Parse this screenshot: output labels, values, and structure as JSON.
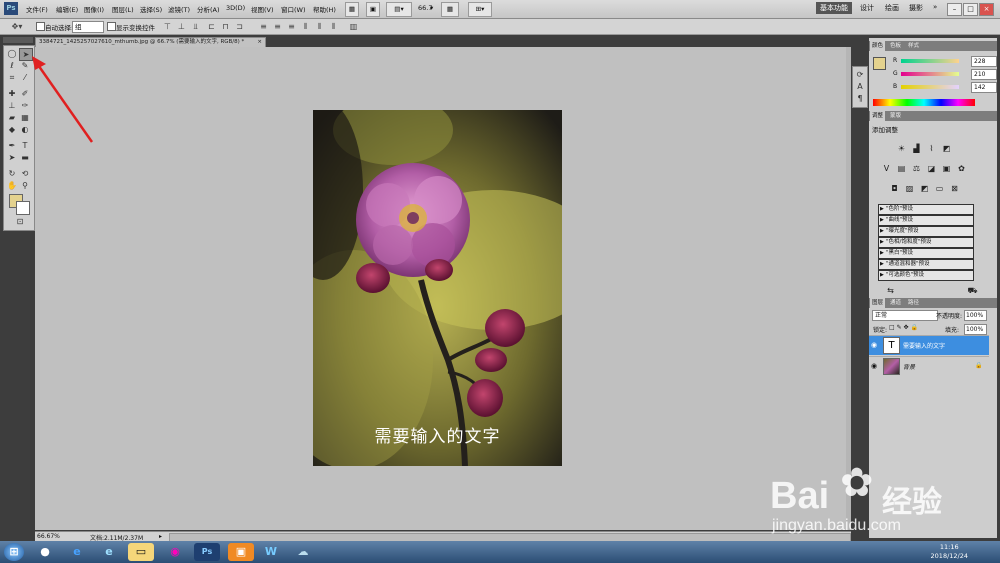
{
  "menubar": {
    "app_badge": "Ps",
    "menus": [
      "文件(F)",
      "编辑(E)",
      "图像(I)",
      "图层(L)",
      "选择(S)",
      "滤镜(T)",
      "分析(A)",
      "3D(D)",
      "视图(V)",
      "窗口(W)",
      "帮助(H)"
    ],
    "zoom": "66.7",
    "workspaces": [
      "基本功能",
      "设计",
      "绘画",
      "摄影"
    ],
    "window_controls": [
      "–",
      "□",
      "×"
    ]
  },
  "options": {
    "auto_select_label": "自动选择:",
    "auto_select_value": "组",
    "show_transform_label": "显示变换控件"
  },
  "document": {
    "tab_title": "3384721_1425257027610_mthumb.jpg @ 66.7% (需要输入的文字, RGB/8) *",
    "image_text": "需要输入的文字"
  },
  "status": {
    "zoom": "66.67%",
    "doc_info": "文档:2.11M/2.37M"
  },
  "color_panel": {
    "tabs": [
      "颜色",
      "色板",
      "样式"
    ],
    "channels": [
      {
        "name": "R",
        "value": "228"
      },
      {
        "name": "G",
        "value": "210"
      },
      {
        "name": "B",
        "value": "142"
      }
    ],
    "swatch_color": "#e4d28e"
  },
  "adjust_panel": {
    "tabs": [
      "调整",
      "蒙版"
    ],
    "title": "添加调整",
    "presets": [
      "\"色阶\"预设",
      "\"曲线\"预设",
      "\"曝光度\"预设",
      "\"色相/饱和度\"预设",
      "\"黑白\"预设",
      "\"通道混和器\"预设",
      "\"可选颜色\"预设"
    ]
  },
  "layers_panel": {
    "tabs": [
      "图层",
      "通道",
      "路径"
    ],
    "blend_mode": "正常",
    "opacity_label": "不透明度:",
    "opacity": "100%",
    "lock_label": "锁定:",
    "fill_label": "填充:",
    "fill": "100%",
    "layers": [
      {
        "name": "需要输入的文字",
        "type": "text",
        "thumb": "T"
      },
      {
        "name": "背景",
        "type": "image"
      }
    ]
  },
  "taskbar": {
    "time": "11:16",
    "date": "2018/12/24"
  },
  "watermark": {
    "brand": "Bai",
    "brand2": "经验",
    "url": "jingyan.baidu.com"
  }
}
